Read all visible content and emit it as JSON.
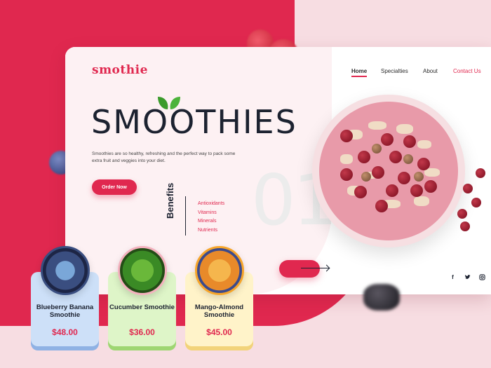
{
  "brand": {
    "logo_text": "smothie"
  },
  "nav": {
    "home": "Home",
    "specialties": "Specialties",
    "about": "About",
    "contact": "Contact Us",
    "active": "Home"
  },
  "hero": {
    "title": "SMOOTHIES",
    "description": "Smoothies are so healthy, refreshing and the perfect way to pack some extra fruit and veggies into your diet.",
    "cta": "Order Now",
    "slide_number": "01"
  },
  "benefits": {
    "label": "Benefits",
    "items": [
      "Antioxidants",
      "Vitamins",
      "Minerals",
      "Nutrients"
    ]
  },
  "socials": [
    "facebook-icon",
    "twitter-icon",
    "instagram-icon"
  ],
  "products": [
    {
      "name": "Blueberry Banana Smoothie",
      "price": "$48.00"
    },
    {
      "name": "Cucumber Smoothie",
      "price": "$36.00"
    },
    {
      "name": "Mango-Almond Smoothie",
      "price": "$45.00"
    }
  ],
  "colors": {
    "accent": "#e0284f",
    "dark": "#1c2230",
    "background": "#f7dde2"
  }
}
